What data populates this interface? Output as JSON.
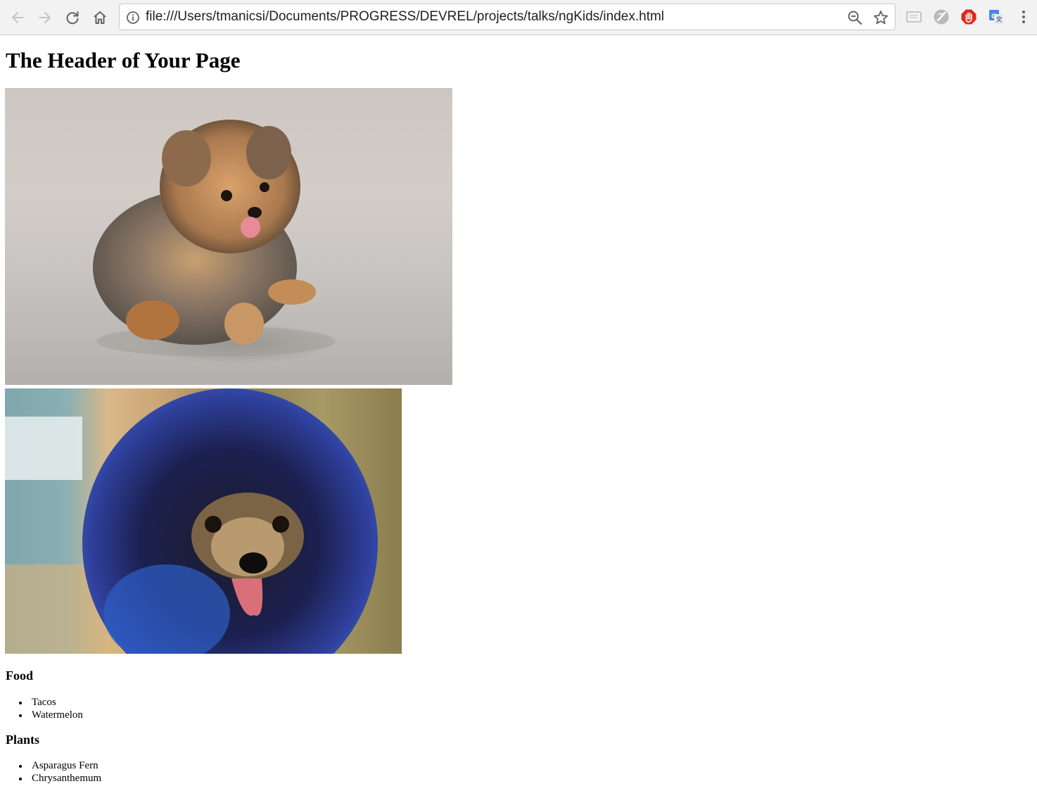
{
  "browser": {
    "url": "file:///Users/tmanicsi/Documents/PROGRESS/DEVREL/projects/talks/ngKids/index.html",
    "nav_icons": [
      "back-arrow-icon",
      "forward-arrow-icon",
      "reload-icon",
      "home-icon"
    ],
    "omnibox_icons": [
      "info-icon",
      "zoom-icon",
      "star-icon"
    ],
    "extension_icons": [
      "cast-icon",
      "shield-extension-icon",
      "stop-hand-icon",
      "translate-icon",
      "more-vert-icon"
    ]
  },
  "page": {
    "title": "The Header of Your Page",
    "images": [
      {
        "subject": "fluffy-puppy-walking-photo"
      },
      {
        "subject": "dark-fluffy-puppy-closeup-photo"
      }
    ],
    "sections": [
      {
        "heading": "Food",
        "items": [
          "Tacos",
          "Watermelon"
        ]
      },
      {
        "heading": "Plants",
        "items": [
          "Asparagus Fern",
          "Chrysanthemum"
        ]
      }
    ]
  },
  "colors": {
    "toolbar_bg": "#f2f2f2",
    "page_bg": "#ffffff",
    "text": "#000000",
    "stop_extension": "#e0261b",
    "translate_extension": "#4a86e8"
  }
}
